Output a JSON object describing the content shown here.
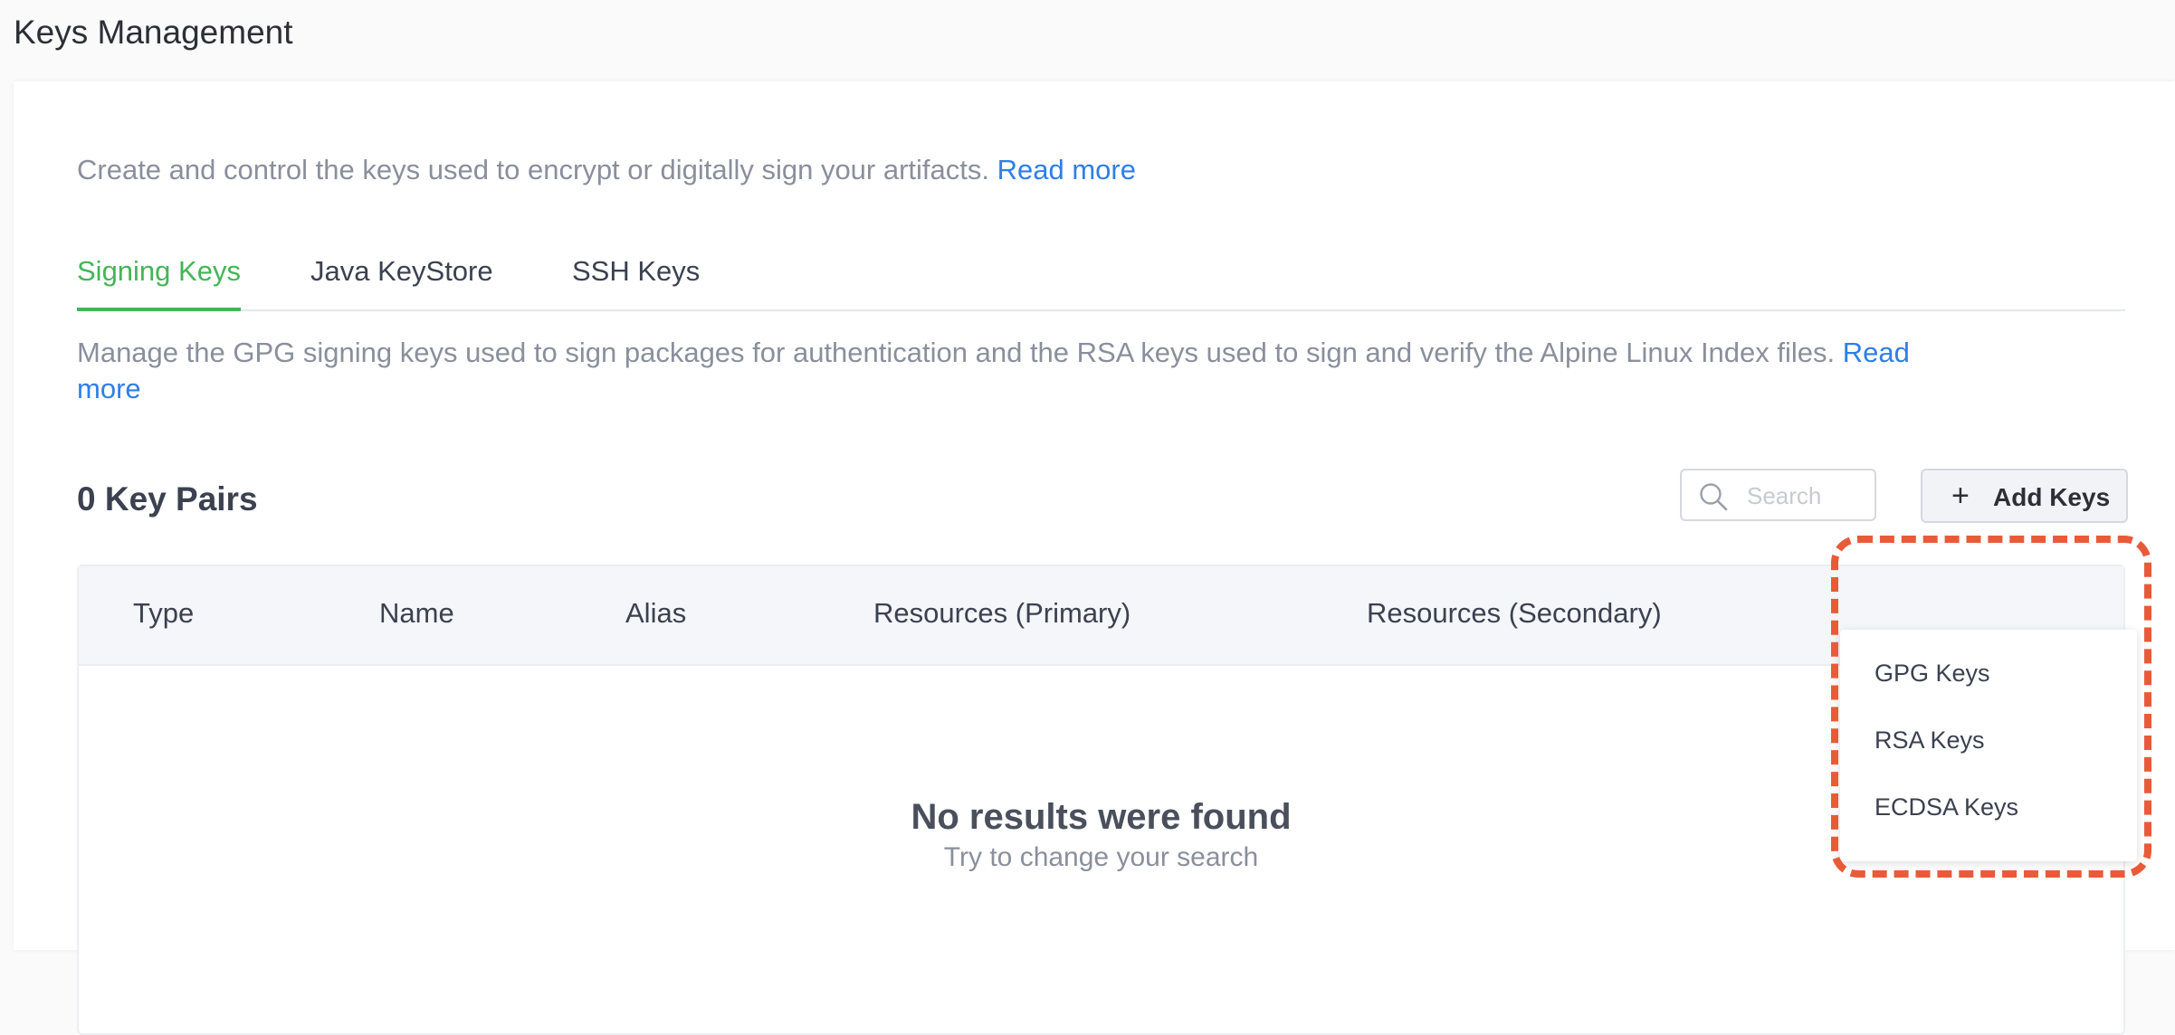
{
  "page": {
    "title": "Keys Management"
  },
  "intro": {
    "text": "Create and control the keys used to encrypt or digitally sign your artifacts.",
    "link": "Read more"
  },
  "tabs": [
    {
      "label": "Signing Keys",
      "active": true
    },
    {
      "label": "Java KeyStore",
      "active": false
    },
    {
      "label": "SSH Keys",
      "active": false
    }
  ],
  "description": {
    "text": "Manage the GPG signing keys used to sign packages for authentication and the RSA keys used to sign and verify the Alpine Linux Index files.",
    "link": "Read more"
  },
  "toolbar": {
    "count_label": "0 Key Pairs",
    "search_placeholder": "Search",
    "add_button_label": "Add Keys",
    "add_button_icon": "plus-icon"
  },
  "table": {
    "columns": [
      "Type",
      "Name",
      "Alias",
      "Resources (Primary)",
      "Resources (Secondary)"
    ],
    "empty_title": "No results were found",
    "empty_subtitle": "Try to change your search"
  },
  "dropdown": {
    "items": [
      "GPG Keys",
      "RSA Keys",
      "ECDSA Keys"
    ]
  },
  "colors": {
    "accent_green": "#44b556",
    "link_blue": "#2f7ee8",
    "highlight_orange": "#ea5a38"
  }
}
